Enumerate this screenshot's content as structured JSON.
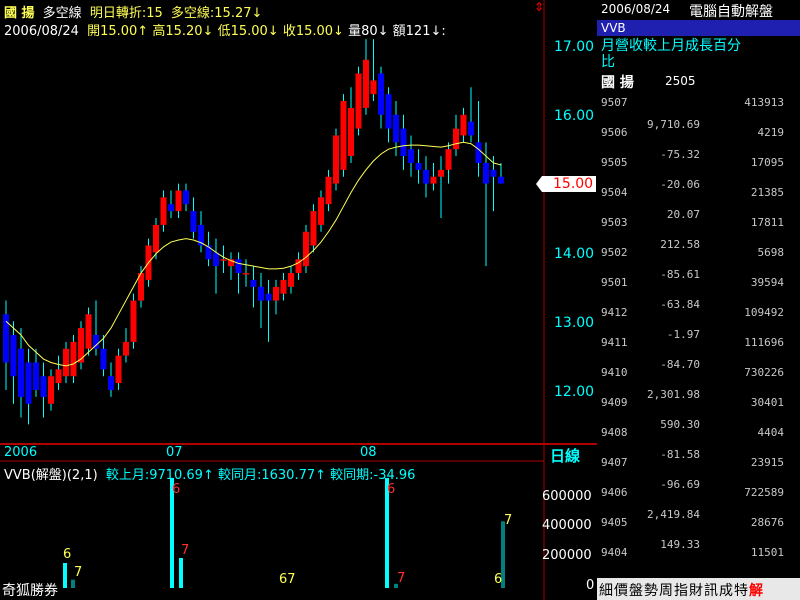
{
  "header": {
    "stock_name": "國  揚",
    "indicator_name": "多空線",
    "turn_label": "明日轉折:15",
    "ma_label": "多空線:15.27↓",
    "date": "2006/08/24",
    "open": "開15.00↑",
    "high": "高15.20↓",
    "low": "低15.00↓",
    "close": "收15.00↓",
    "volume": "量80↓",
    "amount": "額121↓:",
    "marker": "⇕"
  },
  "price_axis": {
    "ticks": [
      "17.00",
      "16.00",
      "15.00",
      "14.00",
      "13.00",
      "12.00"
    ],
    "current_price": "15.00"
  },
  "time_axis": {
    "labels": [
      "2006",
      "07",
      "08"
    ],
    "period": "日線"
  },
  "sub_chart": {
    "title": "VVB(解盤)(2,1)",
    "stat1": "較上月:9710.69↑",
    "stat2": "較同月:1630.77↑",
    "stat3": "較同期:-34.96",
    "ticks": [
      "600000",
      "400000",
      "200000",
      "0"
    ],
    "bar_labels": [
      "6",
      "7",
      "6",
      "7",
      "67",
      "6",
      "7",
      "6",
      "7"
    ]
  },
  "footer": {
    "broker": "奇狐勝券"
  },
  "right_panel": {
    "date": "2006/08/24",
    "title": "電腦自動解盤",
    "tab": "VVB",
    "desc_line1": "月營收較上月成長百分",
    "desc_line2": "比",
    "stock": "國  揚",
    "code": "2505",
    "rows": [
      {
        "code": "9507",
        "a": "",
        "b": "413913"
      },
      {
        "code": "9506",
        "a": "9,710.69",
        "b": "4219"
      },
      {
        "code": "9505",
        "a": "-75.32",
        "b": "17095"
      },
      {
        "code": "9504",
        "a": "-20.06",
        "b": "21385"
      },
      {
        "code": "9503",
        "a": "20.07",
        "b": "17811"
      },
      {
        "code": "9502",
        "a": "212.58",
        "b": "5698"
      },
      {
        "code": "9501",
        "a": "-85.61",
        "b": "39594"
      },
      {
        "code": "9412",
        "a": "-63.84",
        "b": "109492"
      },
      {
        "code": "9411",
        "a": "-1.97",
        "b": "111696"
      },
      {
        "code": "9410",
        "a": "-84.70",
        "b": "730226"
      },
      {
        "code": "9409",
        "a": "2,301.98",
        "b": "30401"
      },
      {
        "code": "9408",
        "a": "590.30",
        "b": "4404"
      },
      {
        "code": "9407",
        "a": "-81.58",
        "b": "23915"
      },
      {
        "code": "9406",
        "a": "-96.69",
        "b": "722589"
      },
      {
        "code": "9405",
        "a": "2,419.84",
        "b": "28676"
      },
      {
        "code": "9404",
        "a": "149.33",
        "b": "11501"
      }
    ],
    "bottom_tabs": [
      "細",
      "價",
      "盤",
      "勢",
      "周",
      "指",
      "財",
      "訊",
      "成",
      "特",
      "解"
    ]
  },
  "colors": {
    "up": "#ff0000",
    "down": "#0000ff",
    "ma": "#ffff55",
    "wick": "#00ffff",
    "axis": "#b00000",
    "accent": "#00ffff"
  },
  "chart_data": {
    "type": "candlestick",
    "ylim": [
      11.5,
      17.2
    ],
    "candles": [
      {
        "o": 13.1,
        "h": 13.3,
        "l": 12.0,
        "c": 12.4
      },
      {
        "o": 12.8,
        "h": 13.0,
        "l": 11.8,
        "c": 12.2
      },
      {
        "o": 12.6,
        "h": 12.9,
        "l": 11.6,
        "c": 11.9
      },
      {
        "o": 12.4,
        "h": 12.6,
        "l": 11.5,
        "c": 11.8
      },
      {
        "o": 12.4,
        "h": 12.6,
        "l": 11.9,
        "c": 12.0
      },
      {
        "o": 12.2,
        "h": 12.4,
        "l": 11.6,
        "c": 11.9
      },
      {
        "o": 11.8,
        "h": 12.3,
        "l": 11.7,
        "c": 12.2
      },
      {
        "o": 12.1,
        "h": 12.5,
        "l": 12.0,
        "c": 12.3
      },
      {
        "o": 12.2,
        "h": 12.7,
        "l": 12.1,
        "c": 12.6
      },
      {
        "o": 12.2,
        "h": 12.8,
        "l": 12.1,
        "c": 12.7
      },
      {
        "o": 12.4,
        "h": 13.0,
        "l": 12.3,
        "c": 12.9
      },
      {
        "o": 12.6,
        "h": 13.2,
        "l": 12.5,
        "c": 13.1
      },
      {
        "o": 12.8,
        "h": 13.3,
        "l": 12.5,
        "c": 12.6
      },
      {
        "o": 12.6,
        "h": 12.8,
        "l": 12.2,
        "c": 12.3
      },
      {
        "o": 12.2,
        "h": 12.4,
        "l": 11.9,
        "c": 12.0
      },
      {
        "o": 12.1,
        "h": 12.6,
        "l": 12.0,
        "c": 12.5
      },
      {
        "o": 12.5,
        "h": 12.9,
        "l": 12.4,
        "c": 12.7
      },
      {
        "o": 12.7,
        "h": 13.4,
        "l": 12.6,
        "c": 13.3
      },
      {
        "o": 13.3,
        "h": 13.8,
        "l": 13.2,
        "c": 13.7
      },
      {
        "o": 13.6,
        "h": 14.2,
        "l": 13.5,
        "c": 14.1
      },
      {
        "o": 14.0,
        "h": 14.5,
        "l": 13.9,
        "c": 14.4
      },
      {
        "o": 14.4,
        "h": 14.9,
        "l": 14.3,
        "c": 14.8
      },
      {
        "o": 14.7,
        "h": 14.9,
        "l": 14.5,
        "c": 14.6
      },
      {
        "o": 14.6,
        "h": 15.0,
        "l": 14.5,
        "c": 14.9
      },
      {
        "o": 14.9,
        "h": 15.0,
        "l": 14.6,
        "c": 14.7
      },
      {
        "o": 14.6,
        "h": 14.8,
        "l": 14.2,
        "c": 14.3
      },
      {
        "o": 14.4,
        "h": 14.6,
        "l": 14.0,
        "c": 14.1
      },
      {
        "o": 14.1,
        "h": 14.3,
        "l": 13.8,
        "c": 13.9
      },
      {
        "o": 14.0,
        "h": 14.2,
        "l": 13.4,
        "c": 13.8
      },
      {
        "o": 13.9,
        "h": 14.1,
        "l": 13.7,
        "c": 13.9
      },
      {
        "o": 13.8,
        "h": 14.0,
        "l": 13.6,
        "c": 13.9
      },
      {
        "o": 13.9,
        "h": 14.0,
        "l": 13.4,
        "c": 13.7
      },
      {
        "o": 13.7,
        "h": 13.9,
        "l": 13.5,
        "c": 13.7
      },
      {
        "o": 13.6,
        "h": 13.8,
        "l": 13.2,
        "c": 13.5
      },
      {
        "o": 13.5,
        "h": 13.7,
        "l": 12.9,
        "c": 13.3
      },
      {
        "o": 13.4,
        "h": 13.6,
        "l": 12.7,
        "c": 13.3
      },
      {
        "o": 13.3,
        "h": 13.6,
        "l": 13.1,
        "c": 13.5
      },
      {
        "o": 13.4,
        "h": 13.7,
        "l": 13.3,
        "c": 13.6
      },
      {
        "o": 13.5,
        "h": 13.8,
        "l": 13.4,
        "c": 13.7
      },
      {
        "o": 13.7,
        "h": 14.0,
        "l": 13.6,
        "c": 13.9
      },
      {
        "o": 13.8,
        "h": 14.4,
        "l": 13.7,
        "c": 14.3
      },
      {
        "o": 14.1,
        "h": 14.7,
        "l": 14.0,
        "c": 14.6
      },
      {
        "o": 14.4,
        "h": 14.9,
        "l": 14.3,
        "c": 14.8
      },
      {
        "o": 14.7,
        "h": 15.2,
        "l": 14.6,
        "c": 15.1
      },
      {
        "o": 15.0,
        "h": 15.8,
        "l": 14.9,
        "c": 15.7
      },
      {
        "o": 15.2,
        "h": 16.3,
        "l": 15.1,
        "c": 16.2
      },
      {
        "o": 15.4,
        "h": 16.4,
        "l": 15.3,
        "c": 16.1
      },
      {
        "o": 15.8,
        "h": 16.7,
        "l": 15.7,
        "c": 16.6
      },
      {
        "o": 16.1,
        "h": 17.1,
        "l": 16.0,
        "c": 16.8
      },
      {
        "o": 16.3,
        "h": 17.1,
        "l": 16.2,
        "c": 16.5
      },
      {
        "o": 16.6,
        "h": 16.7,
        "l": 15.8,
        "c": 16.0
      },
      {
        "o": 16.3,
        "h": 16.4,
        "l": 15.6,
        "c": 15.8
      },
      {
        "o": 16.0,
        "h": 16.2,
        "l": 15.4,
        "c": 15.6
      },
      {
        "o": 15.8,
        "h": 16.0,
        "l": 15.2,
        "c": 15.4
      },
      {
        "o": 15.5,
        "h": 15.7,
        "l": 15.1,
        "c": 15.3
      },
      {
        "o": 15.3,
        "h": 15.5,
        "l": 15.0,
        "c": 15.2
      },
      {
        "o": 15.2,
        "h": 15.4,
        "l": 14.8,
        "c": 15.0
      },
      {
        "o": 15.0,
        "h": 15.3,
        "l": 14.9,
        "c": 15.1
      },
      {
        "o": 15.1,
        "h": 15.4,
        "l": 14.5,
        "c": 15.2
      },
      {
        "o": 15.2,
        "h": 15.6,
        "l": 15.0,
        "c": 15.5
      },
      {
        "o": 15.5,
        "h": 16.0,
        "l": 15.4,
        "c": 15.8
      },
      {
        "o": 15.7,
        "h": 16.1,
        "l": 15.6,
        "c": 16.0
      },
      {
        "o": 15.9,
        "h": 16.4,
        "l": 15.6,
        "c": 15.7
      },
      {
        "o": 15.6,
        "h": 16.2,
        "l": 15.1,
        "c": 15.3
      },
      {
        "o": 15.3,
        "h": 15.6,
        "l": 13.8,
        "c": 15.0
      },
      {
        "o": 15.2,
        "h": 15.4,
        "l": 14.6,
        "c": 15.1
      },
      {
        "o": 15.1,
        "h": 15.3,
        "l": 15.0,
        "c": 15.0
      }
    ],
    "ma": [
      13.0,
      12.9,
      12.8,
      12.65,
      12.55,
      12.45,
      12.4,
      12.37,
      12.35,
      12.38,
      12.45,
      12.55,
      12.65,
      12.75,
      12.9,
      13.1,
      13.3,
      13.5,
      13.7,
      13.85,
      13.98,
      14.08,
      14.15,
      14.18,
      14.2,
      14.18,
      14.14,
      14.08,
      14.0,
      13.93,
      13.88,
      13.84,
      13.82,
      13.8,
      13.78,
      13.76,
      13.76,
      13.77,
      13.8,
      13.85,
      13.93,
      14.03,
      14.15,
      14.3,
      14.47,
      14.67,
      14.87,
      15.05,
      15.2,
      15.33,
      15.43,
      15.5,
      15.53,
      15.55,
      15.56,
      15.56,
      15.55,
      15.54,
      15.53,
      15.55,
      15.58,
      15.6,
      15.58,
      15.5,
      15.4,
      15.3,
      15.27
    ],
    "volume_bars": [
      {
        "x": 65,
        "v": 150000,
        "label": "6"
      },
      {
        "x": 73,
        "v": 50000,
        "label": "7"
      },
      {
        "x": 172,
        "v": 750000,
        "label": "6"
      },
      {
        "x": 181,
        "v": 180000,
        "label": "7"
      },
      {
        "x": 387,
        "v": 750000,
        "label": "6"
      },
      {
        "x": 396,
        "v": 25000,
        "label": "7"
      },
      {
        "x": 503,
        "v": 400000,
        "label": "7"
      }
    ]
  }
}
